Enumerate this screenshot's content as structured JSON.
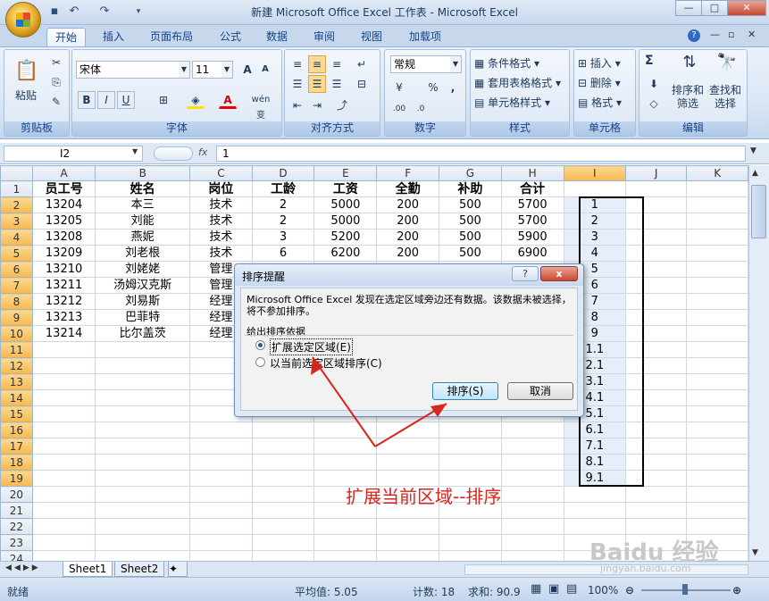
{
  "window": {
    "title": "新建 Microsoft Office Excel 工作表 - Microsoft Excel"
  },
  "ribbon": {
    "tabs": [
      "开始",
      "插入",
      "页面布局",
      "公式",
      "数据",
      "审阅",
      "视图",
      "加载项"
    ],
    "clipboard": {
      "paste": "粘贴",
      "label": "剪贴板"
    },
    "font": {
      "name": "宋体",
      "size": "11",
      "label": "字体",
      "bold": "B",
      "italic": "I",
      "underline": "U",
      "grow": "A",
      "shrink": "A",
      "wen": "wén 变"
    },
    "alignment": {
      "label": "对齐方式"
    },
    "number": {
      "format": "常规",
      "label": "数字",
      "percent": "%",
      "comma": ","
    },
    "styles": {
      "conditional": "条件格式",
      "table": "套用表格格式",
      "cell": "单元格样式",
      "label": "样式"
    },
    "cells": {
      "insert": "插入",
      "delete": "删除",
      "format": "格式",
      "label": "单元格"
    },
    "editing": {
      "sum": "Σ",
      "sort": "排序和\n筛选",
      "find": "查找和\n选择",
      "label": "编辑"
    }
  },
  "formula_bar": {
    "cell": "I2",
    "fx": "fx",
    "value": "1"
  },
  "sheet": {
    "columns": [
      "A",
      "B",
      "C",
      "D",
      "E",
      "F",
      "G",
      "H",
      "I",
      "J",
      "K"
    ],
    "header": [
      "员工号",
      "姓名",
      "岗位",
      "工龄",
      "工资",
      "全勤",
      "补助",
      "合计"
    ],
    "rows": [
      [
        "13204",
        "本三",
        "技术",
        "2",
        "5000",
        "200",
        "500",
        "5700",
        "1"
      ],
      [
        "13205",
        "刘能",
        "技术",
        "2",
        "5000",
        "200",
        "500",
        "5700",
        "2"
      ],
      [
        "13208",
        "燕妮",
        "技术",
        "3",
        "5200",
        "200",
        "500",
        "5900",
        "3"
      ],
      [
        "13209",
        "刘老根",
        "技术",
        "6",
        "6200",
        "200",
        "500",
        "6900",
        "4"
      ],
      [
        "13210",
        "刘姥姥",
        "管理",
        "",
        "",
        "",
        "",
        "",
        "5"
      ],
      [
        "13211",
        "汤姆汉克斯",
        "管理",
        "",
        "",
        "",
        "",
        "",
        "6"
      ],
      [
        "13212",
        "刘易斯",
        "经理",
        "",
        "",
        "",
        "",
        "",
        "7"
      ],
      [
        "13213",
        "巴菲特",
        "经理",
        "",
        "",
        "",
        "",
        "",
        "8"
      ],
      [
        "13214",
        "比尔盖茨",
        "经理",
        "",
        "",
        "",
        "",
        "",
        "9"
      ],
      [
        "",
        "",
        "",
        "",
        "",
        "",
        "",
        "",
        "1.1"
      ],
      [
        "",
        "",
        "",
        "",
        "",
        "",
        "",
        "",
        "2.1"
      ],
      [
        "",
        "",
        "",
        "",
        "",
        "",
        "",
        "",
        "3.1"
      ],
      [
        "",
        "",
        "",
        "",
        "",
        "",
        "",
        "",
        "4.1"
      ],
      [
        "",
        "",
        "",
        "",
        "",
        "",
        "",
        "",
        "5.1"
      ],
      [
        "",
        "",
        "",
        "",
        "",
        "",
        "",
        "",
        "6.1"
      ],
      [
        "",
        "",
        "",
        "",
        "",
        "",
        "",
        "",
        "7.1"
      ],
      [
        "",
        "",
        "",
        "",
        "",
        "",
        "",
        "",
        "8.1"
      ],
      [
        "",
        "",
        "",
        "",
        "",
        "",
        "",
        "",
        "9.1"
      ],
      [
        "",
        "",
        "",
        "",
        "",
        "",
        "",
        "",
        ""
      ],
      [
        "",
        "",
        "",
        "",
        "",
        "",
        "",
        "",
        ""
      ],
      [
        "",
        "",
        "",
        "",
        "",
        "",
        "",
        "",
        ""
      ],
      [
        "",
        "",
        "",
        "",
        "",
        "",
        "",
        "",
        ""
      ],
      [
        "",
        "",
        "",
        "",
        "",
        "",
        "",
        "",
        ""
      ]
    ],
    "tabs": [
      "Sheet1",
      "Sheet2"
    ]
  },
  "dialog": {
    "title": "排序提醒",
    "message": "Microsoft Office Excel 发现在选定区域旁边还有数据。该数据未被选择，将不参加排序。",
    "group_label": "给出排序依据",
    "option1": "扩展选定区域(E)",
    "option2": "以当前选定区域排序(C)",
    "sort_button": "排序(S)",
    "cancel_button": "取消",
    "help": "?",
    "close": "x"
  },
  "annotation": "扩展当前区域--排序",
  "status": {
    "ready": "就绪",
    "average": "平均值: 5.05",
    "count": "计数: 18",
    "sum": "求和: 90.9",
    "zoom": "100%"
  },
  "watermark": {
    "main": "Baidu 经验",
    "url": "jingyan.baidu.com"
  },
  "colors": {
    "accent": "#c7d8ed",
    "annotation": "#d9251c"
  }
}
